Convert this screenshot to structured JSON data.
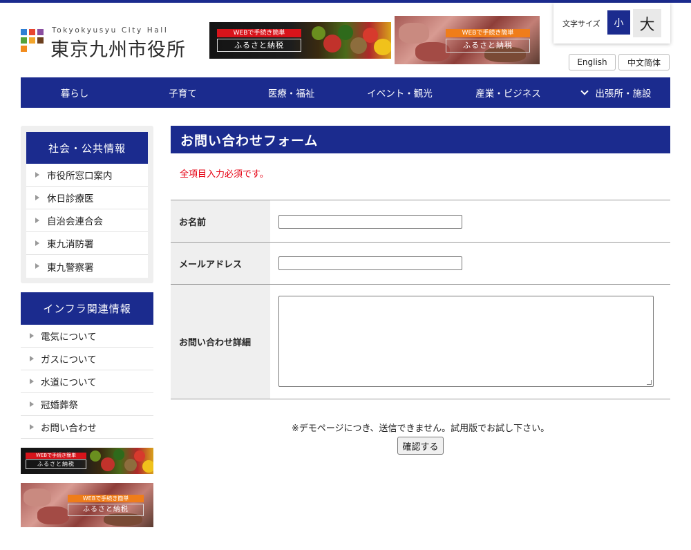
{
  "site": {
    "logo_en": "Tokyokyusyu City Hall",
    "logo_jp": "東京九州市役所",
    "logo_colors": [
      "#e8442f",
      "#f3a52b",
      "#8a4ea0",
      "#2f7fd4",
      "#53a33a",
      "#1b2b8e",
      "#f28b1c",
      "#6b3f1e"
    ]
  },
  "banners": {
    "tag": "WEBで手続き簡単",
    "main": "ふるさと納税"
  },
  "font_size": {
    "label": "文字サイズ",
    "small": "小",
    "large": "大"
  },
  "languages": [
    "English",
    "中文简体"
  ],
  "nav": {
    "items": [
      "暮らし",
      "子育て",
      "医療・福祉",
      "イベント・観光",
      "産業・ビジネス",
      "出張所・施設"
    ]
  },
  "sidebar": {
    "section1": {
      "title": "社会・公共情報",
      "items": [
        "市役所窓口案内",
        "休日診療医",
        "自治会連合会",
        "東九消防署",
        "東九警察署"
      ]
    },
    "section2": {
      "title": "インフラ関連情報",
      "items": [
        "電気について",
        "ガスについて",
        "水道について",
        "冠婚葬祭",
        "お問い合わせ"
      ]
    }
  },
  "form": {
    "title": "お問い合わせフォーム",
    "required_note": "全項目入力必須です。",
    "name_label": "お名前",
    "name_value": "",
    "email_label": "メールアドレス",
    "email_value": "",
    "detail_label": "お問い合わせ詳細",
    "detail_value": "",
    "demo_note": "※デモページにつき、送信できません。試用版でお試し下さい。",
    "confirm_label": "確認する"
  },
  "colors": {
    "primary": "#1b2b8e",
    "required_text": "#e60012"
  }
}
